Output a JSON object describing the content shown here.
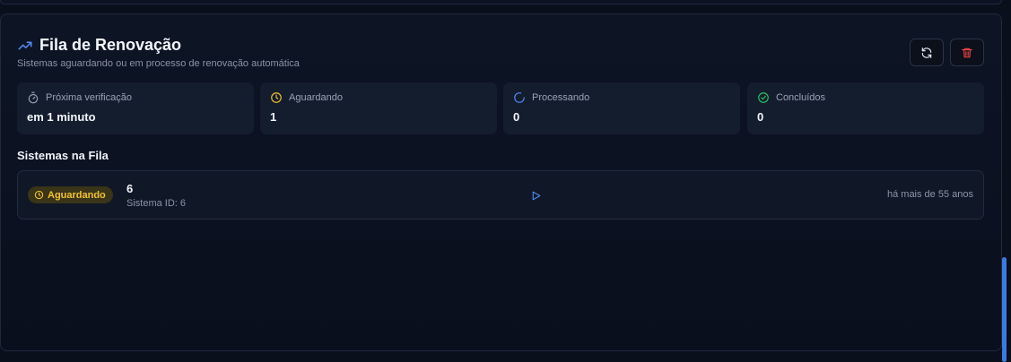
{
  "header": {
    "title": "Fila de Renovação",
    "subtitle": "Sistemas aguardando ou em processo de renovação automática",
    "icon": "trending-up-icon"
  },
  "actions": {
    "refresh_icon": "refresh-icon",
    "delete_icon": "trash-icon"
  },
  "stats": [
    {
      "label": "Próxima verificação",
      "value": "em 1 minuto",
      "icon": "timer-icon"
    },
    {
      "label": "Aguardando",
      "value": "1",
      "icon": "clock-icon",
      "color": "#f2c230"
    },
    {
      "label": "Processando",
      "value": "0",
      "icon": "spinner-icon",
      "color": "#4f8ff7"
    },
    {
      "label": "Concluídos",
      "value": "0",
      "icon": "check-circle-icon",
      "color": "#22c55e"
    }
  ],
  "queue": {
    "title": "Sistemas na Fila",
    "items": [
      {
        "status": "Aguardando",
        "name": "6",
        "system_id": "Sistema ID: 6",
        "time": "há mais de 55 anos"
      }
    ]
  },
  "colors": {
    "accent": "#4f8ff7",
    "warning": "#f2c230",
    "danger": "#ef4444",
    "success": "#22c55e"
  }
}
